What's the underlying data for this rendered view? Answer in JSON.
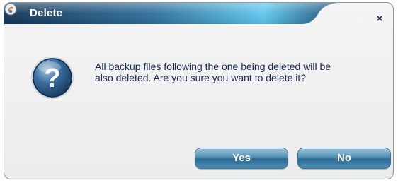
{
  "window": {
    "title": "Delete",
    "title_icon": "backup-app-icon",
    "close_label": "×",
    "close_icon": "close-icon"
  },
  "dialog": {
    "icon": "question-icon",
    "icon_glyph": "?",
    "message_line1": "All backup files following the one being deleted will be",
    "message_line2": "also deleted. Are you sure you want to delete it?"
  },
  "buttons": {
    "yes_label": "Yes",
    "no_label": "No"
  },
  "colors": {
    "title_bar": "#1c3f63",
    "accent": "#2d6a92",
    "text": "#1b2a52"
  }
}
